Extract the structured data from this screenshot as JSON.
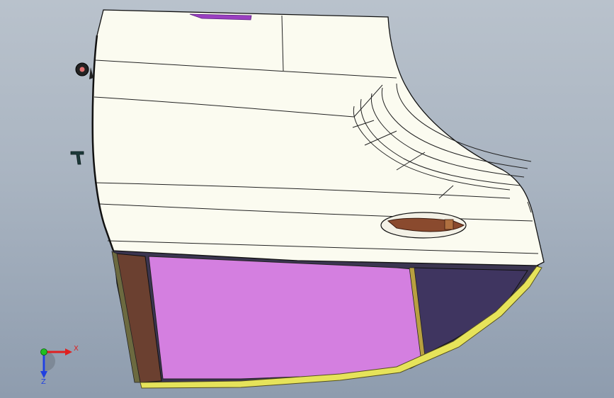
{
  "viewport": {
    "background_top": "#b9c2cc",
    "background_bottom": "#8e9cae"
  },
  "model": {
    "name": "car-door",
    "colors": {
      "outer_panel": "#fbfbf0",
      "inner_panel": "#d47fe0",
      "inner_panel_dark": "#3f3560",
      "frame_edge": "#6b4030",
      "seal_strip": "#e6e35a",
      "handle": "#8a4a2e",
      "edge_line": "#1a1a1a"
    }
  },
  "triad": {
    "x_label": "X",
    "z_label": "Z",
    "x_color": "#e02020",
    "y_color": "#20c020",
    "z_color": "#2040e0"
  }
}
